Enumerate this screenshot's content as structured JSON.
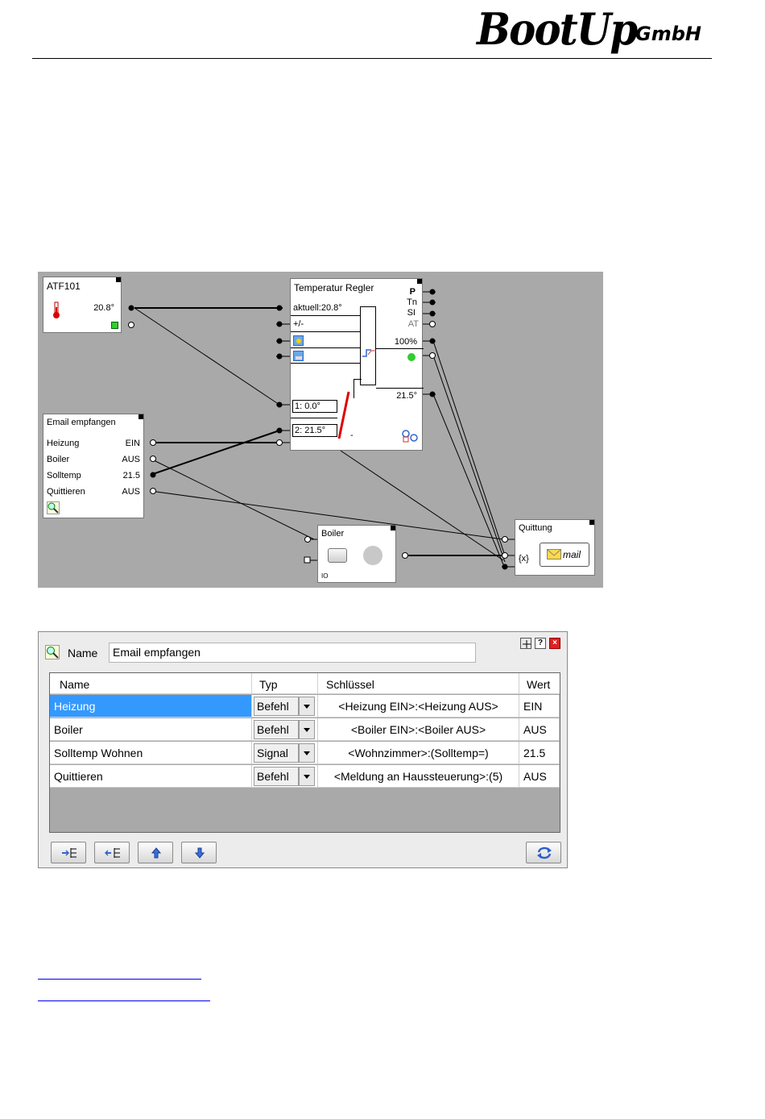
{
  "header": {
    "logo_main": "BootUp",
    "logo_sub": "GmbH"
  },
  "diagram": {
    "atf": {
      "title": "ATF101",
      "value": "20.8°"
    },
    "regler": {
      "title": "Temperatur Regler",
      "outputs": [
        "P",
        "Tn",
        "SI",
        "AT"
      ],
      "aktuell": "aktuell:20.8°",
      "plusminus": "+/-",
      "pct": "100%",
      "setpoint_out": "21.5°",
      "in1": "1: 0.0°",
      "in2": "2: 21.5°",
      "dash": "-"
    },
    "email": {
      "title": "Email empfangen",
      "rows": [
        {
          "name": "Heizung",
          "value": "EIN"
        },
        {
          "name": "Boiler",
          "value": "AUS"
        },
        {
          "name": "Solltemp",
          "value": "21.5"
        },
        {
          "name": "Quittieren",
          "value": "AUS"
        }
      ]
    },
    "boiler": {
      "title": "Boiler",
      "io": "IO"
    },
    "quittung": {
      "title": "Quittung",
      "fx": "{x}",
      "mail": "mail"
    }
  },
  "dialog": {
    "name_label": "Name",
    "name_value": "Email empfangen",
    "columns": [
      "Name",
      "Typ",
      "Schlüssel",
      "Wert"
    ],
    "rows": [
      {
        "name": "Heizung",
        "typ": "Befehl",
        "key": "<Heizung EIN>:<Heizung AUS>",
        "wert": "EIN"
      },
      {
        "name": "Boiler",
        "typ": "Befehl",
        "key": "<Boiler EIN>:<Boiler AUS>",
        "wert": "AUS"
      },
      {
        "name": "Solltemp Wohnen",
        "typ": "Signal",
        "key": "<Wohnzimmer>:(Solltemp=)",
        "wert": "21.5"
      },
      {
        "name": "Quittieren",
        "typ": "Befehl",
        "key": "<Meldung an Haussteuerung>:(5)",
        "wert": "AUS"
      }
    ],
    "help_icon": "?",
    "close_icon": "×"
  }
}
